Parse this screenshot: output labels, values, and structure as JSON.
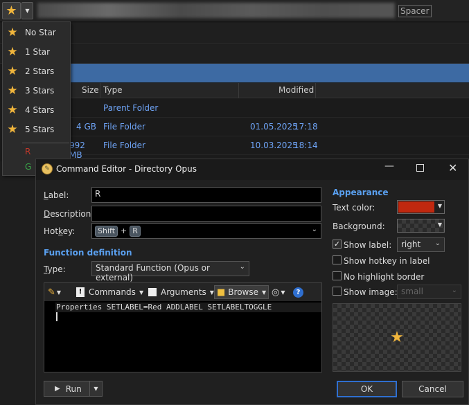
{
  "toolbar": {
    "spacer": "Spacer"
  },
  "menu": {
    "items": [
      "No Star",
      "1 Star",
      "2 Stars",
      "3 Stars",
      "4 Stars",
      "5 Stars"
    ],
    "colored": [
      {
        "label": "R",
        "color": "#c0382b"
      },
      {
        "label": "G",
        "color": "#3aa84a"
      }
    ]
  },
  "lister": {
    "columns": {
      "size": "Size",
      "type": "Type",
      "modified": "Modified"
    },
    "rows": [
      {
        "size": "",
        "type": "Parent Folder",
        "date": "",
        "time": ""
      },
      {
        "size": "4 GB",
        "type": "File Folder",
        "date": "01.05.2025",
        "time": "17:18"
      },
      {
        "size": "992 MB",
        "type": "File Folder",
        "date": "10.03.2025",
        "time": "18:14"
      }
    ]
  },
  "dialog": {
    "title": "Command Editor - Directory Opus",
    "label_caption": "Label:",
    "label_value": "R",
    "description_caption": "Description:",
    "description_value": "",
    "hotkey_caption": "Hotkey:",
    "hotkey_keys": [
      "Shift",
      "R"
    ],
    "hotkey_plus": "+",
    "function_header": "Function definition",
    "type_caption": "Type:",
    "type_value": "Standard Function (Opus or external)",
    "editor_toolbar": {
      "commands": "Commands",
      "arguments": "Arguments",
      "browse": "Browse"
    },
    "command_text": "Properties SETLABEL=Red ADDLABEL SETLABELTOGGLE",
    "run": "Run",
    "appearance_header": "Appearance",
    "text_color_caption": "Text color:",
    "text_color_value": "#c0280f",
    "background_caption": "Background:",
    "show_label_caption": "Show label:",
    "show_label_checked": true,
    "show_label_value": "right",
    "show_hotkey_caption": "Show hotkey in label",
    "no_highlight_caption": "No highlight border",
    "show_image_caption": "Show image:",
    "show_image_value": "small",
    "ok": "OK",
    "cancel": "Cancel"
  },
  "colors": {
    "accent": "#5aa0f0",
    "star": "#f0b53c",
    "link": "#6ea3f5"
  }
}
